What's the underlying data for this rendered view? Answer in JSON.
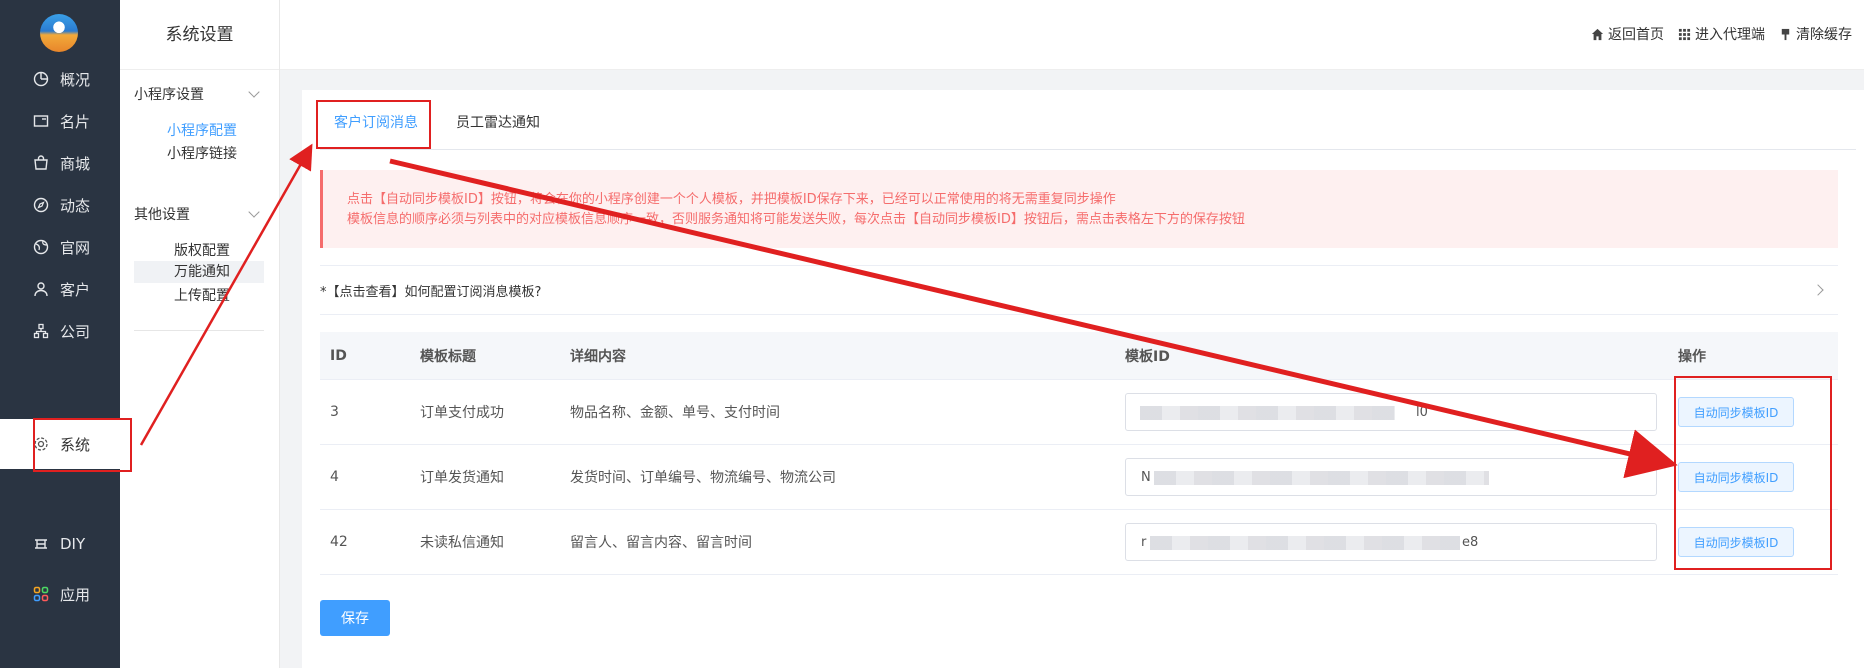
{
  "nav": {
    "items": [
      {
        "label": "概况",
        "icon": "pie-chart-icon"
      },
      {
        "label": "名片",
        "icon": "card-icon"
      },
      {
        "label": "商城",
        "icon": "shop-icon"
      },
      {
        "label": "动态",
        "icon": "compass-icon"
      },
      {
        "label": "官网",
        "icon": "globe-icon"
      },
      {
        "label": "客户",
        "icon": "user-icon"
      },
      {
        "label": "公司",
        "icon": "org-icon"
      },
      {
        "label": "系统",
        "icon": "gear-icon"
      },
      {
        "label": "DIY",
        "icon": "diy-icon"
      },
      {
        "label": "应用",
        "icon": "apps-icon"
      }
    ],
    "active": "系统"
  },
  "submenu": {
    "title": "系统设置",
    "group1": {
      "label": "小程序设置",
      "items": [
        "小程序配置",
        "小程序链接"
      ]
    },
    "group2": {
      "label": "其他设置",
      "items": [
        "版权配置",
        "万能通知",
        "上传配置"
      ]
    }
  },
  "topbar": {
    "home": "返回首页",
    "agent": "进入代理端",
    "cache": "清除缓存"
  },
  "tabs": [
    "客户订阅消息",
    "员工雷达通知"
  ],
  "alert": {
    "line1": "点击【自动同步模板ID】按钮，将会在你的小程序创建一个个人模板，并把模板ID保存下来，已经可以正常使用的将无需重复同步操作",
    "line2": "模板信息的顺序必须与列表中的对应模板信息顺序一致，否则服务通知将可能发送失败，每次点击【自动同步模板ID】按钮后，需点击表格左下方的保存按钮"
  },
  "collapse": {
    "label": "*【点击查看】如何配置订阅消息模板?"
  },
  "table": {
    "headers": [
      "ID",
      "模板标题",
      "详细内容",
      "模板ID",
      "操作"
    ],
    "rows": [
      {
        "id": "3",
        "title": "订单支付成功",
        "content": "物品名称、金额、单号、支付时间",
        "template_prefix": "",
        "template_suffix": "l0"
      },
      {
        "id": "4",
        "title": "订单发货通知",
        "content": "发货时间、订单编号、物流编号、物流公司",
        "template_prefix": "N",
        "template_suffix": ""
      },
      {
        "id": "42",
        "title": "未读私信通知",
        "content": "留言人、留言内容、留言时间",
        "template_prefix": "r",
        "template_suffix": "e8"
      }
    ],
    "action_label": "自动同步模板ID"
  },
  "save_label": "保存",
  "colors": {
    "primary": "#409eff",
    "nav_bg": "#2a3442",
    "annotation": "#e02020",
    "alert": "#f56c6c"
  }
}
